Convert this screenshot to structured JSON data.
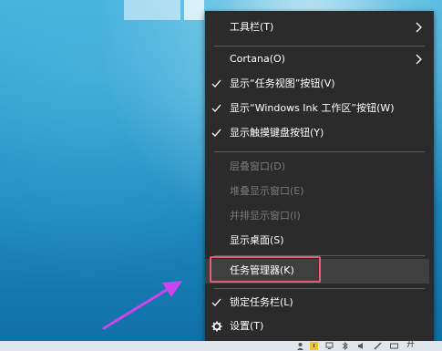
{
  "context_menu": {
    "items": [
      {
        "label": "工具栏(T)",
        "has_submenu": true,
        "checked": false,
        "enabled": true
      },
      {
        "label": "Cortana(O)",
        "has_submenu": true,
        "checked": false,
        "enabled": true
      },
      {
        "label": "显示“任务视图”按钮(V)",
        "has_submenu": false,
        "checked": true,
        "enabled": true
      },
      {
        "label": "显示“Windows Ink 工作区”按钮(W)",
        "has_submenu": false,
        "checked": true,
        "enabled": true
      },
      {
        "label": "显示触摸键盘按钮(Y)",
        "has_submenu": false,
        "checked": true,
        "enabled": true
      },
      {
        "label": "层叠窗口(D)",
        "has_submenu": false,
        "checked": false,
        "enabled": false
      },
      {
        "label": "堆叠显示窗口(E)",
        "has_submenu": false,
        "checked": false,
        "enabled": false
      },
      {
        "label": "并排显示窗口(I)",
        "has_submenu": false,
        "checked": false,
        "enabled": false
      },
      {
        "label": "显示桌面(S)",
        "has_submenu": false,
        "checked": false,
        "enabled": true
      },
      {
        "label": "任务管理器(K)",
        "has_submenu": false,
        "checked": false,
        "enabled": true,
        "highlighted": true
      },
      {
        "label": "锁定任务栏(L)",
        "has_submenu": false,
        "checked": true,
        "enabled": true
      },
      {
        "label": "设置(T)",
        "has_submenu": false,
        "checked": false,
        "enabled": true,
        "icon": "gear-icon"
      }
    ]
  },
  "annotation": {
    "highlight_color": "#ea5b7a",
    "arrow_color": "#cc44ee"
  },
  "colors": {
    "menu_background": "#2b2b2b",
    "menu_text": "#ffffff",
    "menu_text_disabled": "#7a7a7a",
    "separator": "#5c5c5c",
    "hover_background": "#3f3f3f"
  },
  "taskbar": {
    "tray_text": "开"
  }
}
